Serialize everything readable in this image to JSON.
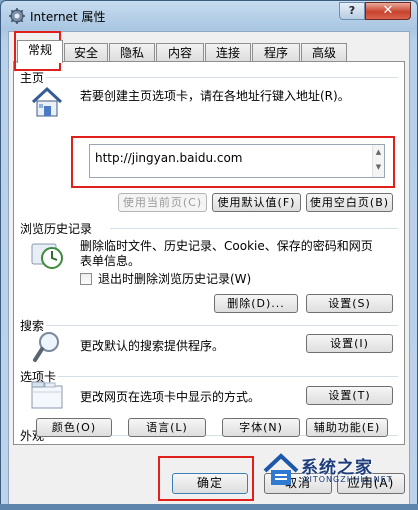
{
  "window": {
    "title": "Internet 属性",
    "help_label": "?",
    "close_label": "✕"
  },
  "tabs": [
    {
      "label": "常规",
      "active": true
    },
    {
      "label": "安全"
    },
    {
      "label": "隐私"
    },
    {
      "label": "内容"
    },
    {
      "label": "连接"
    },
    {
      "label": "程序"
    },
    {
      "label": "高级"
    }
  ],
  "homepage": {
    "title": "主页",
    "description": "若要创建主页选项卡，请在各地址行键入地址(R)。",
    "url_value": "http://jingyan.baidu.com",
    "buttons": {
      "use_current": "使用当前页(C)",
      "use_default": "使用默认值(F)",
      "use_blank": "使用空白页(B)"
    }
  },
  "history": {
    "title": "浏览历史记录",
    "description_line1": "删除临时文件、历史记录、Cookie、保存的密码和网页",
    "description_line2": "表单信息。",
    "checkbox_label": "退出时删除浏览历史记录(W)",
    "checkbox_checked": false,
    "buttons": {
      "delete": "删除(D)...",
      "settings": "设置(S)"
    }
  },
  "search": {
    "title": "搜索",
    "description": "更改默认的搜索提供程序。",
    "settings_label": "设置(I)"
  },
  "tabs_section": {
    "title": "选项卡",
    "description": "更改网页在选项卡中显示的方式。",
    "settings_label": "设置(T)"
  },
  "appearance": {
    "title": "外观",
    "buttons": {
      "colors": "颜色(O)",
      "languages": "语言(L)",
      "fonts": "字体(N)",
      "accessibility": "辅助功能(E)"
    }
  },
  "footer": {
    "ok": "确定",
    "cancel": "取消",
    "apply": "应用(A)"
  },
  "watermark": {
    "text": "系统之家",
    "sub": "XITONGZHIJIA.NET"
  },
  "colors": {
    "highlight_border": "#e0211b",
    "window_frame": "#a9c6e2"
  }
}
